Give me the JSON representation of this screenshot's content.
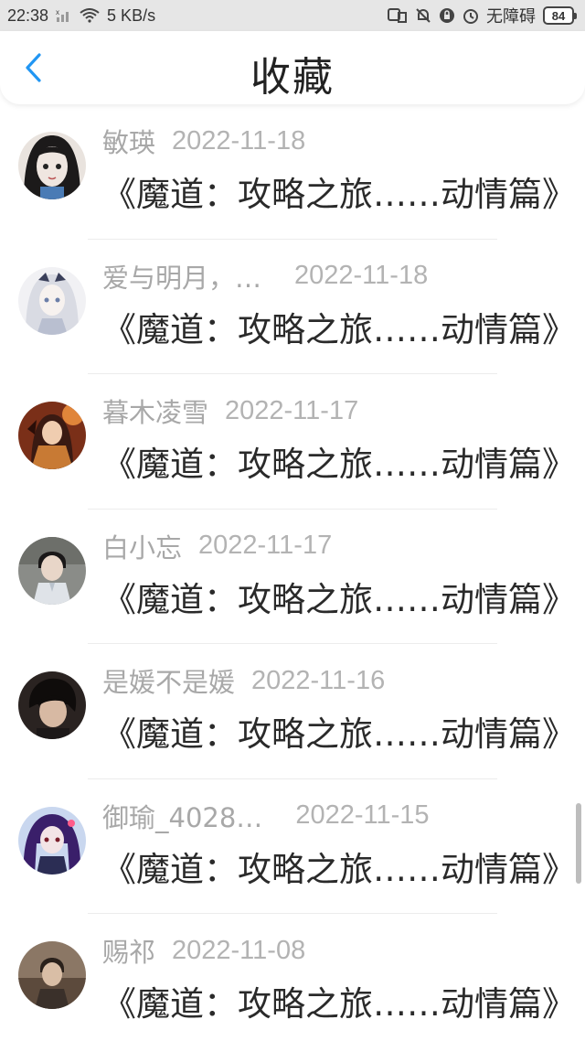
{
  "status_bar": {
    "time": "22:38",
    "network_speed": "5 KB/s",
    "accessibility": "无障碍",
    "battery": "84"
  },
  "header": {
    "title": "收藏"
  },
  "favorites": [
    {
      "name": "敏瑛",
      "date": "2022-11-18",
      "title": "《魔道：攻略之旅……动情篇》"
    },
    {
      "name": "爱与明月，…",
      "date": "2022-11-18",
      "title": "《魔道：攻略之旅……动情篇》"
    },
    {
      "name": "暮木凌雪",
      "date": "2022-11-17",
      "title": "《魔道：攻略之旅……动情篇》"
    },
    {
      "name": "白小忘",
      "date": "2022-11-17",
      "title": "《魔道：攻略之旅……动情篇》"
    },
    {
      "name": "是媛不是媛",
      "date": "2022-11-16",
      "title": "《魔道：攻略之旅……动情篇》"
    },
    {
      "name": "御瑜_4028…",
      "date": "2022-11-15",
      "title": "《魔道：攻略之旅……动情篇》"
    },
    {
      "name": "赐祁",
      "date": "2022-11-08",
      "title": "《魔道：攻略之旅……动情篇》"
    }
  ],
  "colors": {
    "accent": "#2196f3",
    "name_text": "#a8a8a8",
    "title_text": "#2a2a2a"
  }
}
